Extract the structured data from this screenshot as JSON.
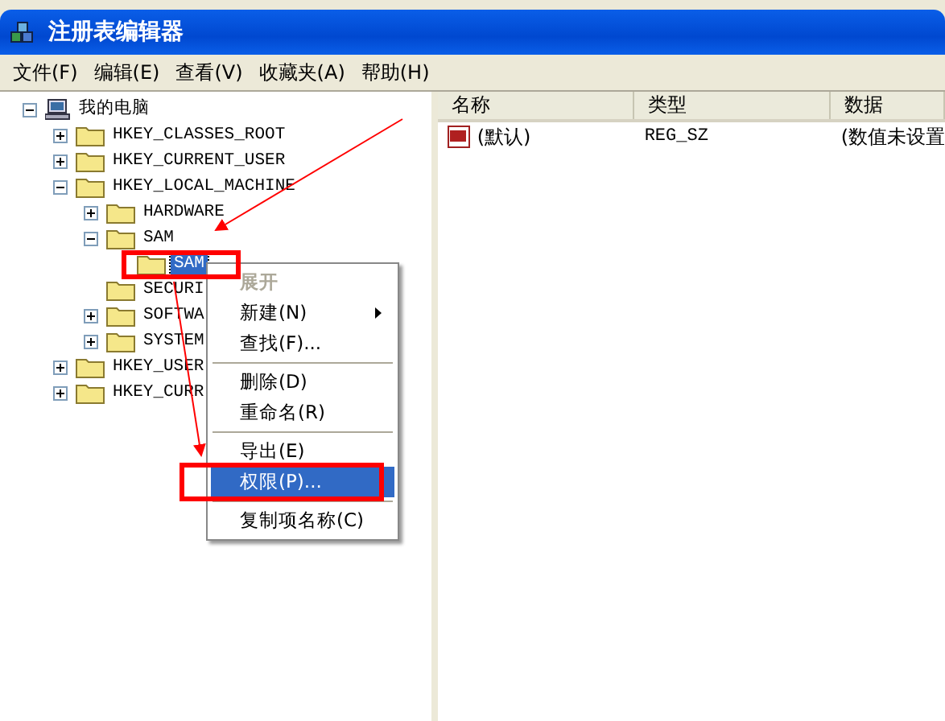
{
  "window": {
    "title": "注册表编辑器"
  },
  "menu": [
    "文件(F)",
    "编辑(E)",
    "查看(V)",
    "收藏夹(A)",
    "帮助(H)"
  ],
  "tree": [
    {
      "label": "我的电脑",
      "kind": "computer",
      "expanded": true,
      "selected": false,
      "children": [
        {
          "label": "HKEY_CLASSES_ROOT",
          "kind": "folder",
          "expanded": false,
          "selected": false
        },
        {
          "label": "HKEY_CURRENT_USER",
          "kind": "folder",
          "expanded": false,
          "selected": false
        },
        {
          "label": "HKEY_LOCAL_MACHINE",
          "kind": "folder",
          "expanded": true,
          "selected": false,
          "children": [
            {
              "label": "HARDWARE",
              "kind": "folder",
              "expanded": false,
              "selected": false
            },
            {
              "label": "SAM",
              "kind": "folder",
              "expanded": true,
              "selected": false,
              "children": [
                {
                  "label": "SAM",
                  "kind": "leaf",
                  "selected": true
                }
              ]
            },
            {
              "label": "SECURI",
              "kind": "leaf",
              "selected": false
            },
            {
              "label": "SOFTWA",
              "kind": "folder",
              "expanded": false,
              "selected": false
            },
            {
              "label": "SYSTEM",
              "kind": "folder",
              "expanded": false,
              "selected": false
            }
          ]
        },
        {
          "label": "HKEY_USER",
          "kind": "folder",
          "expanded": false,
          "selected": false
        },
        {
          "label": "HKEY_CURR",
          "kind": "folder",
          "expanded": false,
          "selected": false
        }
      ]
    }
  ],
  "list": {
    "columns": [
      "名称",
      "类型",
      "数据"
    ],
    "rows": [
      {
        "name": "(默认)",
        "type": "REG_SZ",
        "data": "(数值未设置"
      }
    ]
  },
  "context_menu": [
    {
      "kind": "item",
      "label": "展开",
      "default": true,
      "disabled": true,
      "selected": false,
      "submenu": false
    },
    {
      "kind": "item",
      "label": "新建(N)",
      "default": false,
      "disabled": false,
      "selected": false,
      "submenu": true
    },
    {
      "kind": "item",
      "label": "查找(F)...",
      "default": false,
      "disabled": false,
      "selected": false,
      "submenu": false
    },
    {
      "kind": "separator"
    },
    {
      "kind": "item",
      "label": "删除(D)",
      "default": false,
      "disabled": false,
      "selected": false,
      "submenu": false
    },
    {
      "kind": "item",
      "label": "重命名(R)",
      "default": false,
      "disabled": false,
      "selected": false,
      "submenu": false
    },
    {
      "kind": "separator"
    },
    {
      "kind": "item",
      "label": "导出(E)",
      "default": false,
      "disabled": false,
      "selected": false,
      "submenu": false
    },
    {
      "kind": "item",
      "label": "权限(P)...",
      "default": false,
      "disabled": false,
      "selected": true,
      "submenu": false
    },
    {
      "kind": "separator"
    },
    {
      "kind": "item",
      "label": "复制项名称(C)",
      "default": false,
      "disabled": false,
      "selected": false,
      "submenu": false
    }
  ]
}
